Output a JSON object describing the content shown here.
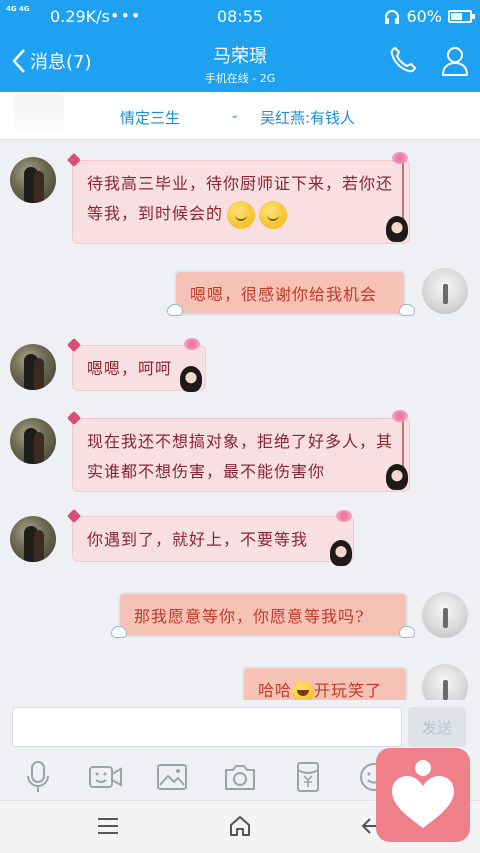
{
  "status_bar": {
    "network": "4G 4G",
    "speed": "0.29K/s",
    "dots": "•••",
    "time": "08:55",
    "battery_percent": "60%",
    "battery_level": 0.6
  },
  "header": {
    "back_label": "消息(7)",
    "title": "马荣璟",
    "subtitle": "手机在线 - 2G",
    "phone_icon": "phone-icon",
    "profile_icon": "person-icon"
  },
  "pinned": {
    "left_text": "情定三生",
    "separator": "-",
    "right_text": "吴红燕:有钱人"
  },
  "messages": [
    {
      "from": "her",
      "text": "待我高三毕业，待你厨师证下来，若你还等我，到时候会的",
      "emoji": "smile-emoji",
      "emoji_count": 2
    },
    {
      "from": "me",
      "text": "嗯嗯，很感谢你给我机会"
    },
    {
      "from": "her",
      "text": "嗯嗯，呵呵"
    },
    {
      "from": "her",
      "text": "现在我还不想搞对象，拒绝了好多人，其实谁都不想伤害，最不能伤害你"
    },
    {
      "from": "her",
      "text": "你遇到了，就好上，不要等我"
    },
    {
      "from": "me",
      "text": "那我愿意等你，你愿意等我吗?"
    },
    {
      "from": "me",
      "text_before": "哈哈",
      "emoji": "grin-emoji",
      "text_after": "开玩笑了"
    }
  ],
  "input": {
    "value": "",
    "placeholder": "",
    "send_label": "发送"
  },
  "toolbar": {
    "items": [
      "microphone-icon",
      "video-icon",
      "image-icon",
      "camera-icon",
      "red-packet-icon",
      "emoji-icon"
    ]
  },
  "navbar": {
    "items": [
      "menu-icon",
      "home-icon",
      "back-icon"
    ]
  },
  "floating_button": "heart-app-icon",
  "colors": {
    "accent": "#1ea1f0",
    "incoming_bubble": "#f8dfe2",
    "outgoing_bubble": "#f6c2b5",
    "floating": "#ef7f88"
  }
}
